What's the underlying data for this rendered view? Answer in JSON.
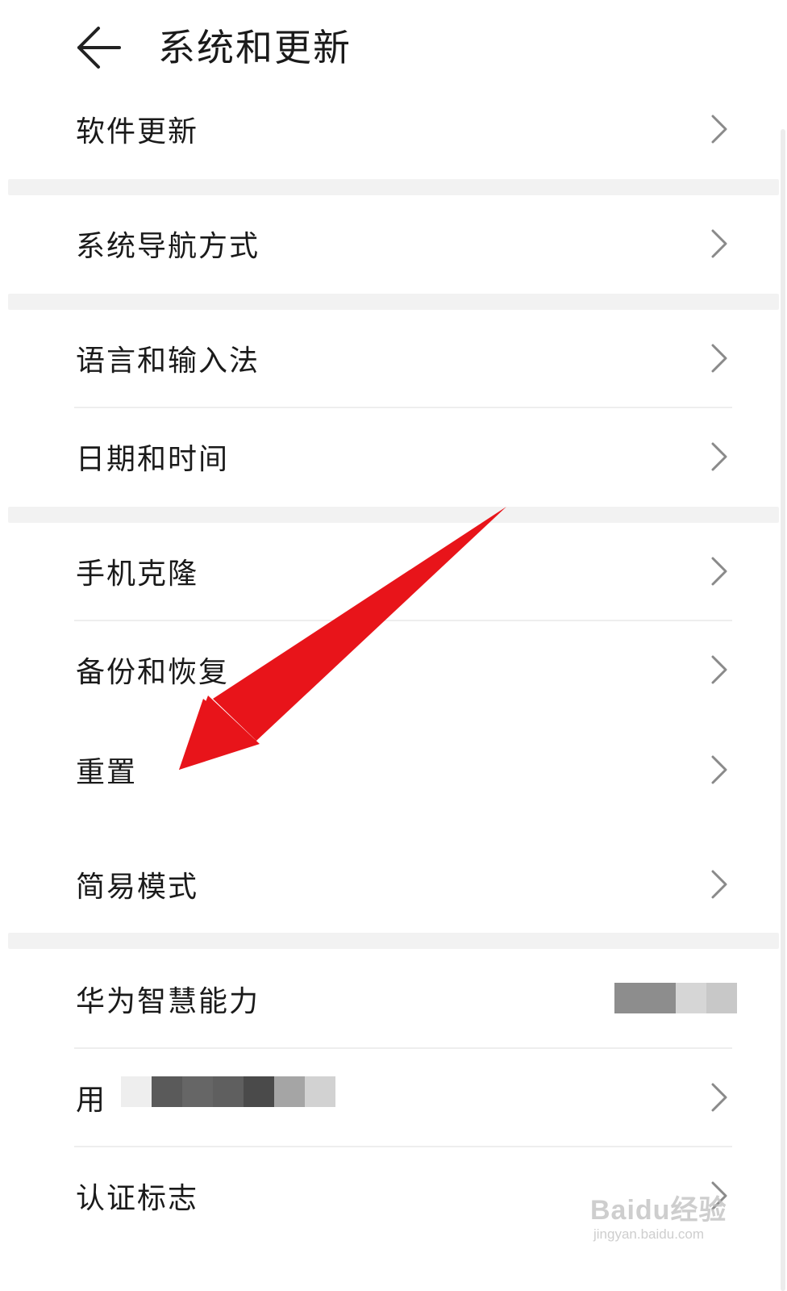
{
  "header": {
    "back_icon": "arrow-left-icon",
    "title": "系统和更新"
  },
  "items": [
    {
      "label": "软件更新",
      "icon": "chevron-right-icon"
    },
    {
      "label": "系统导航方式",
      "icon": "chevron-right-icon"
    },
    {
      "label": "语言和输入法",
      "icon": "chevron-right-icon"
    },
    {
      "label": "日期和时间",
      "icon": "chevron-right-icon"
    },
    {
      "label": "手机克隆",
      "icon": "chevron-right-icon"
    },
    {
      "label": "备份和恢复",
      "icon": "chevron-right-icon"
    },
    {
      "label": "重置",
      "icon": "chevron-right-icon"
    },
    {
      "label": "简易模式",
      "icon": "chevron-right-icon"
    },
    {
      "label": "华为智慧能力",
      "icon": "toggle-blurred"
    },
    {
      "label": "用",
      "icon": "chevron-right-icon"
    },
    {
      "label": "认证标志",
      "icon": "chevron-right-icon"
    }
  ],
  "annotation": {
    "arrow_color": "#e8141a",
    "target_item": "重置"
  },
  "watermark": {
    "main": "Baidu经验",
    "sub": "jingyan.baidu.com"
  },
  "colors": {
    "text": "#1a1a1a",
    "chevron": "#8a8a8a",
    "gap": "#f2f2f2",
    "divider": "#eeeeee"
  }
}
